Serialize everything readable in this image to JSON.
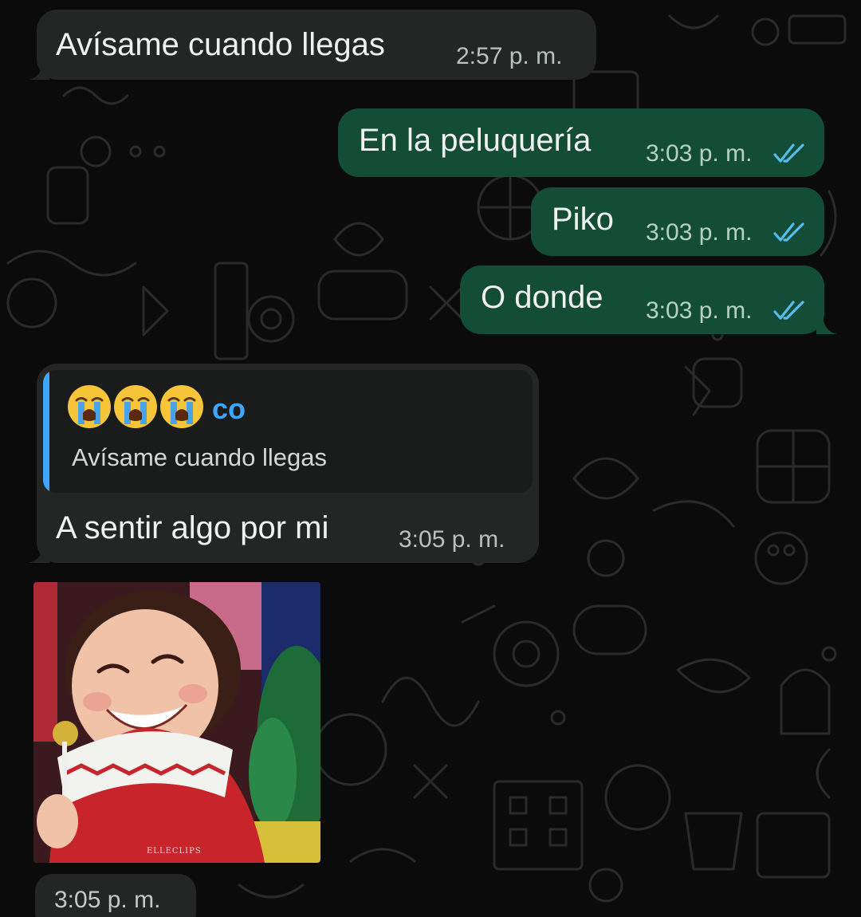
{
  "colors": {
    "background": "#0b0b0b",
    "incoming_bubble": "#242626",
    "outgoing_bubble": "#144d37",
    "read_ticks": "#53bdeb",
    "quote_accent": "#3ea6ff"
  },
  "messages": [
    {
      "direction": "incoming",
      "text": "Avísame cuando llegas",
      "time": "2:57 p. m."
    },
    {
      "direction": "outgoing",
      "text": "En la peluquería",
      "time": "3:03 p. m.",
      "status": "read-double-check-icon"
    },
    {
      "direction": "outgoing",
      "text": "Piko",
      "time": "3:03 p. m.",
      "status": "read-double-check-icon"
    },
    {
      "direction": "outgoing",
      "text": "O donde",
      "time": "3:03 p. m.",
      "status": "read-double-check-icon"
    },
    {
      "direction": "incoming",
      "reply_to": {
        "author_suffix": "co",
        "author_emoji": "loudly-crying-face-icon",
        "text": "Avísame cuando llegas"
      },
      "text": "A sentir algo por mi",
      "time": "3:05 p. m."
    },
    {
      "direction": "incoming",
      "media": {
        "type": "gif",
        "subject": "smiling-girl-with-lollipop",
        "watermark": "ELLECLIPS"
      },
      "time": "3:05 p. m."
    }
  ]
}
